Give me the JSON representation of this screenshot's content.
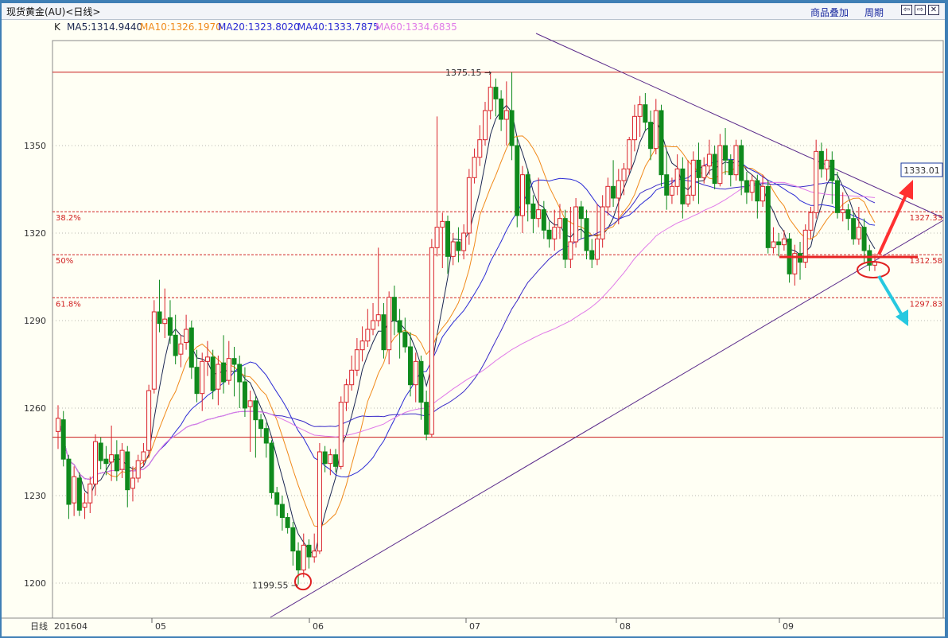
{
  "window": {
    "title": "现货黄金(AU)<日线>",
    "overlay_link": "商品叠加",
    "period_link": "周期",
    "nav_icons": [
      "arrow-left-icon",
      "arrow-right-icon",
      "close-icon"
    ]
  },
  "legend": {
    "k_label": "K",
    "ma5": "MA5:1314.9440",
    "ma10": "MA10:1326.1970",
    "ma20": "MA20:1323.8020",
    "ma40": "MA40:1333.7875",
    "ma60": "MA60:1334.6835"
  },
  "colors": {
    "up": "#d9222a",
    "down": "#0f8a1c",
    "ma5": "#1a2650",
    "ma10": "#f08a1a",
    "ma20": "#2a2ad4",
    "ma40": "#3a2ac8",
    "ma60": "#e07ae8",
    "background": "#fffff4",
    "arrow_up": "#ff3030",
    "arrow_down": "#27c8e0"
  },
  "chart_data": {
    "type": "candlestick",
    "x_label": "日线",
    "x_ticks": [
      "201604",
      "05",
      "06",
      "07",
      "08",
      "09"
    ],
    "y_ticks": [
      1200,
      1230,
      1260,
      1290,
      1320,
      1350
    ],
    "ylim": [
      1188,
      1386
    ],
    "grid": true,
    "high_label": "1375.15",
    "low_label": "1199.55",
    "fib_levels": [
      {
        "label": "38.2%",
        "value": 1327.33,
        "value_label": "1327.33"
      },
      {
        "label": "50%",
        "value": 1312.58,
        "value_label": "1312.58"
      },
      {
        "label": "61.8%",
        "value": 1297.83,
        "value_label": "1297.83"
      }
    ],
    "resistance_line_value": 1375.15,
    "support_line_value": 1250,
    "last_price_label": "1333.01",
    "candles": [
      [
        1252.0,
        1256.5,
        1261.0,
        1246.0
      ],
      [
        1256.0,
        1242.5,
        1259.0,
        1240.0
      ],
      [
        1242.5,
        1227.0,
        1244.0,
        1222.0
      ],
      [
        1227.5,
        1236.5,
        1240.0,
        1223.0
      ],
      [
        1236.0,
        1225.0,
        1238.0,
        1223.0
      ],
      [
        1226.0,
        1227.5,
        1231.0,
        1222.0
      ],
      [
        1227.5,
        1234.0,
        1236.5,
        1224.0
      ],
      [
        1234.0,
        1248.5,
        1251.0,
        1230.0
      ],
      [
        1248.0,
        1242.0,
        1250.0,
        1239.0
      ],
      [
        1242.5,
        1241.0,
        1247.0,
        1237.0
      ],
      [
        1241.5,
        1244.0,
        1254.0,
        1235.0
      ],
      [
        1244.0,
        1238.5,
        1249.0,
        1235.0
      ],
      [
        1239.0,
        1245.5,
        1248.0,
        1236.0
      ],
      [
        1245.0,
        1232.0,
        1247.0,
        1226.0
      ],
      [
        1232.5,
        1236.0,
        1240.0,
        1228.0
      ],
      [
        1236.0,
        1242.0,
        1244.0,
        1234.5
      ],
      [
        1242.0,
        1245.0,
        1248.0,
        1240.0
      ],
      [
        1245.5,
        1266.0,
        1268.0,
        1243.0
      ],
      [
        1266.5,
        1293.0,
        1297.0,
        1265.0
      ],
      [
        1293.0,
        1289.0,
        1304.0,
        1286.0
      ],
      [
        1289.0,
        1290.5,
        1301.0,
        1284.0
      ],
      [
        1291.0,
        1285.0,
        1297.0,
        1282.0
      ],
      [
        1285.0,
        1278.0,
        1292.0,
        1275.0
      ],
      [
        1278.5,
        1282.0,
        1285.0,
        1274.0
      ],
      [
        1282.5,
        1287.0,
        1292.0,
        1280.0
      ],
      [
        1287.5,
        1274.0,
        1290.0,
        1270.0
      ],
      [
        1274.0,
        1265.0,
        1280.0,
        1262.0
      ],
      [
        1265.0,
        1276.0,
        1279.0,
        1259.0
      ],
      [
        1276.0,
        1277.5,
        1283.0,
        1271.0
      ],
      [
        1277.5,
        1266.0,
        1280.0,
        1263.0
      ],
      [
        1266.5,
        1275.0,
        1278.0,
        1261.0
      ],
      [
        1275.5,
        1269.0,
        1285.0,
        1265.0
      ],
      [
        1269.5,
        1277.0,
        1283.0,
        1268.0
      ],
      [
        1277.0,
        1275.0,
        1281.0,
        1264.0
      ],
      [
        1275.0,
        1269.0,
        1278.0,
        1260.0
      ],
      [
        1269.0,
        1260.0,
        1274.0,
        1257.0
      ],
      [
        1260.5,
        1262.5,
        1266.0,
        1245.0
      ],
      [
        1262.5,
        1256.0,
        1264.0,
        1243.0
      ],
      [
        1256.0,
        1253.0,
        1258.0,
        1250.0
      ],
      [
        1253.0,
        1248.0,
        1255.0,
        1243.0
      ],
      [
        1248.0,
        1231.0,
        1249.0,
        1229.0
      ],
      [
        1231.0,
        1227.0,
        1233.0,
        1223.0
      ],
      [
        1227.0,
        1222.5,
        1230.0,
        1218.0
      ],
      [
        1222.5,
        1219.0,
        1224.0,
        1217.0
      ],
      [
        1219.0,
        1211.0,
        1221.0,
        1206.0
      ],
      [
        1211.0,
        1204.5,
        1214.0,
        1199.55
      ],
      [
        1204.5,
        1213.0,
        1217.0,
        1202.0
      ],
      [
        1213.0,
        1209.0,
        1215.0,
        1205.0
      ],
      [
        1209.0,
        1211.0,
        1217.0,
        1207.0
      ],
      [
        1211.0,
        1245.0,
        1248.0,
        1210.0
      ],
      [
        1245.0,
        1241.0,
        1247.0,
        1238.0
      ],
      [
        1241.0,
        1244.0,
        1246.0,
        1237.0
      ],
      [
        1244.0,
        1240.0,
        1246.0,
        1238.0
      ],
      [
        1240.0,
        1262.0,
        1264.0,
        1239.0
      ],
      [
        1262.0,
        1268.0,
        1270.0,
        1259.0
      ],
      [
        1268.0,
        1273.0,
        1278.0,
        1266.0
      ],
      [
        1273.0,
        1280.0,
        1284.0,
        1271.0
      ],
      [
        1280.0,
        1283.0,
        1288.0,
        1276.0
      ],
      [
        1283.0,
        1287.0,
        1294.0,
        1281.0
      ],
      [
        1287.0,
        1290.0,
        1296.0,
        1285.0
      ],
      [
        1290.0,
        1292.0,
        1315.0,
        1288.0
      ],
      [
        1292.0,
        1280.0,
        1296.0,
        1277.0
      ],
      [
        1280.0,
        1298.0,
        1300.0,
        1275.0
      ],
      [
        1298.0,
        1290.0,
        1302.0,
        1285.0
      ],
      [
        1290.0,
        1286.0,
        1294.0,
        1277.0
      ],
      [
        1286.0,
        1281.0,
        1291.0,
        1279.0
      ],
      [
        1281.0,
        1268.0,
        1286.0,
        1264.0
      ],
      [
        1268.0,
        1276.0,
        1279.0,
        1262.0
      ],
      [
        1276.0,
        1262.0,
        1278.0,
        1256.0
      ],
      [
        1262.0,
        1251.0,
        1266.0,
        1249.0
      ],
      [
        1251.0,
        1315.0,
        1318.0,
        1250.0
      ],
      [
        1315.0,
        1322.0,
        1360.0,
        1312.0
      ],
      [
        1322.0,
        1324.0,
        1327.0,
        1308.0
      ],
      [
        1324.0,
        1312.0,
        1326.0,
        1306.0
      ],
      [
        1312.0,
        1317.0,
        1320.0,
        1309.0
      ],
      [
        1317.0,
        1314.0,
        1322.0,
        1310.0
      ],
      [
        1314.0,
        1320.0,
        1323.0,
        1311.0
      ],
      [
        1320.0,
        1339.0,
        1342.0,
        1316.0
      ],
      [
        1339.0,
        1346.0,
        1349.0,
        1337.0
      ],
      [
        1346.0,
        1352.0,
        1357.0,
        1343.0
      ],
      [
        1352.0,
        1362.0,
        1365.0,
        1350.0
      ],
      [
        1362.0,
        1370.0,
        1375.15,
        1359.0
      ],
      [
        1370.0,
        1366.0,
        1373.0,
        1360.0
      ],
      [
        1366.0,
        1359.0,
        1369.0,
        1355.0
      ],
      [
        1359.0,
        1362.0,
        1372.0,
        1350.0
      ],
      [
        1362.0,
        1350.0,
        1375.15,
        1345.0
      ],
      [
        1350.0,
        1326.0,
        1353.0,
        1322.0
      ],
      [
        1326.0,
        1340.0,
        1343.0,
        1320.0
      ],
      [
        1340.0,
        1330.0,
        1342.0,
        1324.0
      ],
      [
        1330.0,
        1325.0,
        1333.0,
        1320.0
      ],
      [
        1325.0,
        1328.0,
        1339.0,
        1322.0
      ],
      [
        1328.0,
        1321.0,
        1331.0,
        1318.0
      ],
      [
        1321.0,
        1318.0,
        1324.0,
        1315.0
      ],
      [
        1318.0,
        1322.0,
        1328.0,
        1314.0
      ],
      [
        1322.0,
        1325.0,
        1330.0,
        1318.0
      ],
      [
        1325.0,
        1311.0,
        1328.0,
        1308.0
      ],
      [
        1311.0,
        1317.0,
        1329.0,
        1308.0
      ],
      [
        1317.0,
        1329.0,
        1332.0,
        1315.0
      ],
      [
        1329.0,
        1325.0,
        1331.0,
        1318.0
      ],
      [
        1325.0,
        1314.0,
        1328.0,
        1311.0
      ],
      [
        1314.0,
        1311.0,
        1318.0,
        1308.0
      ],
      [
        1311.0,
        1318.0,
        1330.0,
        1309.0
      ],
      [
        1318.0,
        1329.0,
        1333.0,
        1315.0
      ],
      [
        1329.0,
        1336.0,
        1339.0,
        1326.0
      ],
      [
        1336.0,
        1332.0,
        1345.0,
        1329.0
      ],
      [
        1332.0,
        1338.0,
        1342.0,
        1323.0
      ],
      [
        1338.0,
        1342.0,
        1344.0,
        1333.0
      ],
      [
        1342.0,
        1352.0,
        1353.0,
        1340.0
      ],
      [
        1352.0,
        1360.0,
        1364.0,
        1348.0
      ],
      [
        1360.0,
        1364.0,
        1367.0,
        1353.0
      ],
      [
        1364.0,
        1358.0,
        1368.0,
        1355.0
      ],
      [
        1358.0,
        1349.0,
        1362.0,
        1345.0
      ],
      [
        1349.0,
        1362.0,
        1366.0,
        1347.0
      ],
      [
        1362.0,
        1340.0,
        1364.0,
        1336.0
      ],
      [
        1340.0,
        1333.0,
        1348.0,
        1328.0
      ],
      [
        1333.0,
        1336.0,
        1339.0,
        1330.0
      ],
      [
        1336.0,
        1342.0,
        1347.0,
        1333.0
      ],
      [
        1342.0,
        1330.0,
        1346.0,
        1325.0
      ],
      [
        1330.0,
        1333.0,
        1345.0,
        1329.0
      ],
      [
        1333.0,
        1345.0,
        1348.0,
        1331.0
      ],
      [
        1345.0,
        1339.0,
        1351.0,
        1330.0
      ],
      [
        1339.0,
        1343.0,
        1346.0,
        1337.0
      ],
      [
        1343.0,
        1347.0,
        1352.0,
        1340.0
      ],
      [
        1347.0,
        1337.0,
        1350.0,
        1335.0
      ],
      [
        1337.0,
        1350.0,
        1354.0,
        1336.0
      ],
      [
        1350.0,
        1345.0,
        1356.0,
        1340.0
      ],
      [
        1345.0,
        1340.0,
        1347.0,
        1336.0
      ],
      [
        1340.0,
        1350.0,
        1352.0,
        1338.0
      ],
      [
        1350.0,
        1338.0,
        1352.0,
        1333.0
      ],
      [
        1338.0,
        1334.0,
        1341.0,
        1330.0
      ],
      [
        1334.0,
        1338.0,
        1340.0,
        1331.0
      ],
      [
        1338.0,
        1331.0,
        1340.0,
        1325.0
      ],
      [
        1331.0,
        1336.0,
        1340.0,
        1329.0
      ],
      [
        1336.0,
        1315.0,
        1338.0,
        1313.0
      ],
      [
        1315.0,
        1317.0,
        1322.0,
        1313.0
      ],
      [
        1317.0,
        1316.0,
        1320.0,
        1312.0
      ],
      [
        1316.0,
        1318.0,
        1321.0,
        1314.0
      ],
      [
        1318.0,
        1306.0,
        1320.0,
        1303.0
      ],
      [
        1306.0,
        1313.0,
        1316.0,
        1302.0
      ],
      [
        1313.0,
        1310.0,
        1317.0,
        1304.0
      ],
      [
        1310.0,
        1321.0,
        1323.0,
        1308.0
      ],
      [
        1321.0,
        1327.0,
        1329.0,
        1318.0
      ],
      [
        1327.0,
        1348.0,
        1352.0,
        1325.0
      ],
      [
        1348.0,
        1342.0,
        1351.0,
        1339.0
      ],
      [
        1342.0,
        1345.0,
        1349.0,
        1338.0
      ],
      [
        1345.0,
        1338.0,
        1348.0,
        1330.0
      ],
      [
        1338.0,
        1327.0,
        1341.0,
        1325.0
      ],
      [
        1327.0,
        1328.0,
        1334.0,
        1324.0
      ],
      [
        1328.0,
        1325.0,
        1330.0,
        1321.0
      ],
      [
        1325.0,
        1318.0,
        1327.0,
        1316.0
      ],
      [
        1318.0,
        1322.0,
        1329.0,
        1316.0
      ],
      [
        1322.0,
        1314.0,
        1325.0,
        1310.0
      ],
      [
        1314.0,
        1309.0,
        1316.0,
        1307.0
      ],
      [
        1309.0,
        1310.0,
        1313.0,
        1307.0
      ]
    ]
  }
}
